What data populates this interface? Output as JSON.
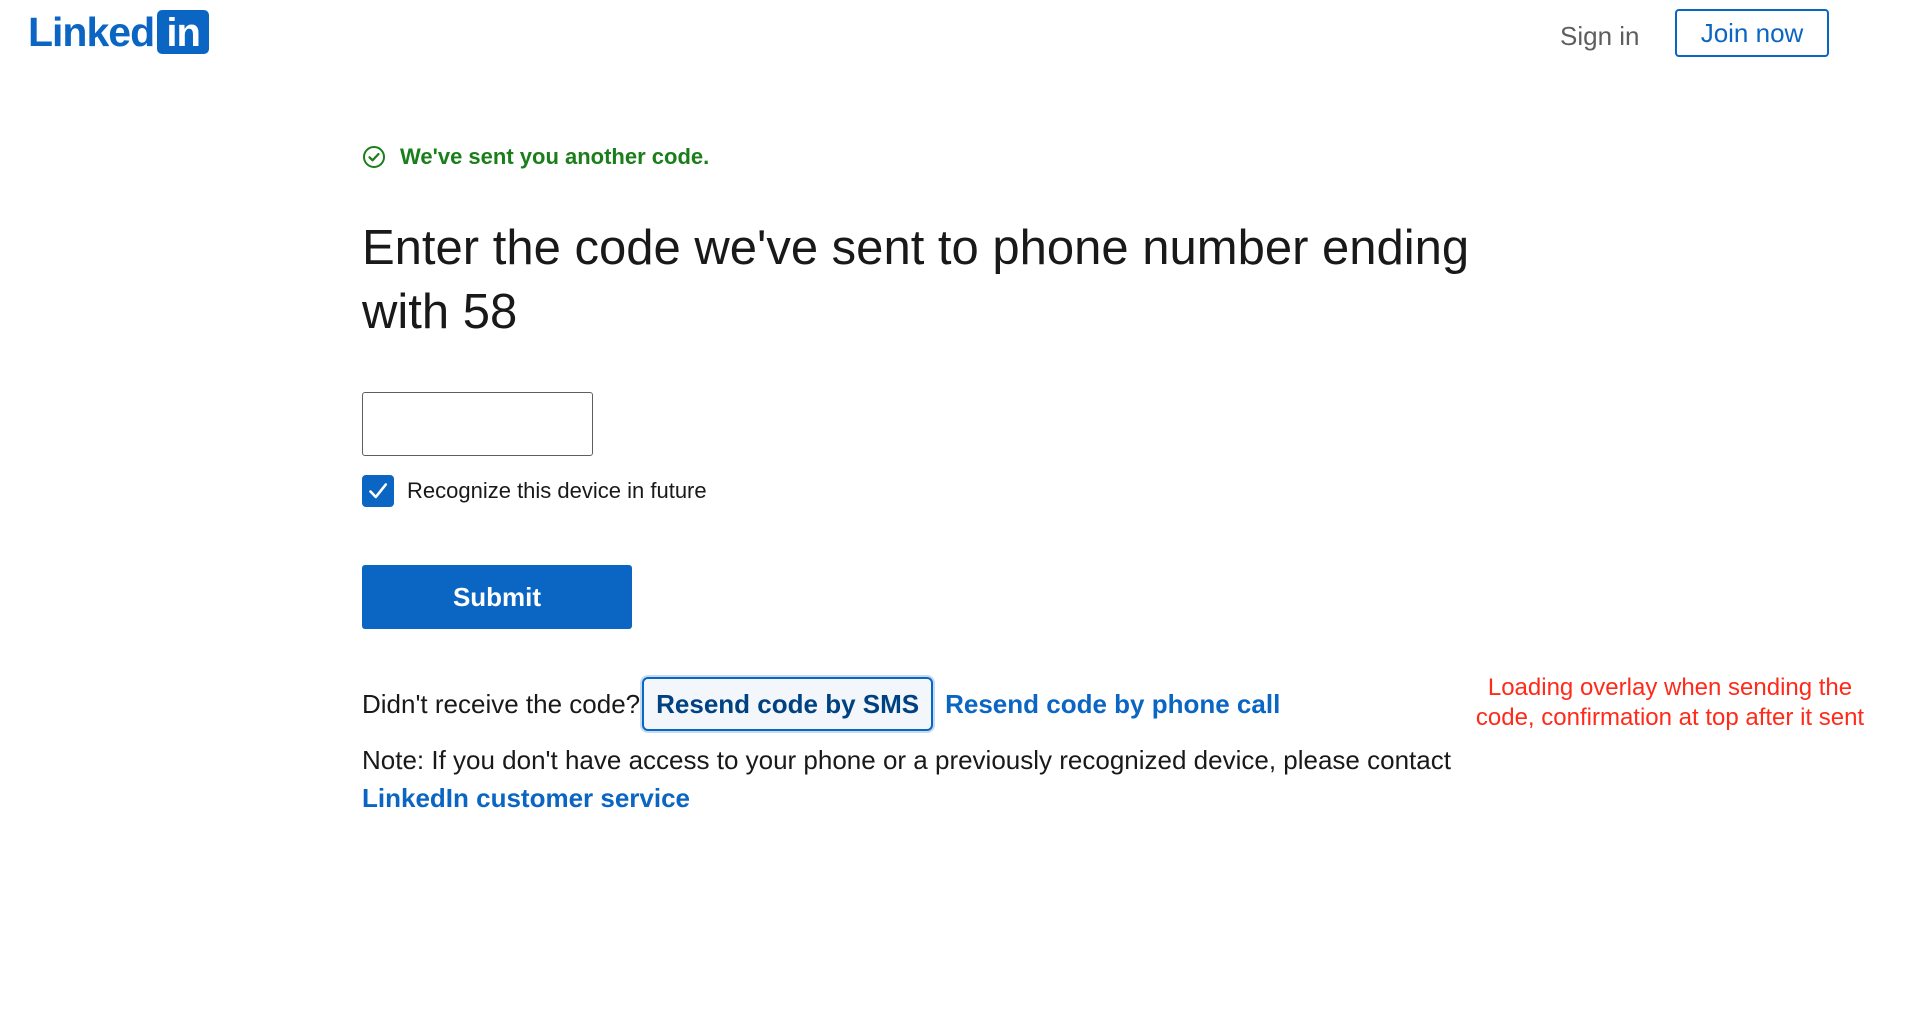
{
  "header": {
    "logo_text": "Linked",
    "logo_box_text": "in",
    "sign_in_label": "Sign in",
    "join_now_label": "Join now"
  },
  "confirmation": {
    "icon": "check-circle-icon",
    "text": "We've sent you another code."
  },
  "form": {
    "title": "Enter the code we've sent to phone number ending with 58",
    "code_input_value": "",
    "remember_checked": true,
    "remember_label": "Recognize this device in future",
    "submit_label": "Submit"
  },
  "resend": {
    "prompt": "Didn't receive the code?",
    "sms_label": "Resend code by SMS",
    "call_label": "Resend code by phone call"
  },
  "note": {
    "text": "Note: If you don't have access to your phone or a previously recognized device, please contact",
    "link_label": "LinkedIn customer service"
  },
  "annotation": {
    "text": "Loading overlay when sending the code, confirmation at top after it sent"
  },
  "colors": {
    "brand_blue": "#0a66c2",
    "success_green": "#1a7f1a",
    "annotation_red": "#ff2a1a"
  }
}
